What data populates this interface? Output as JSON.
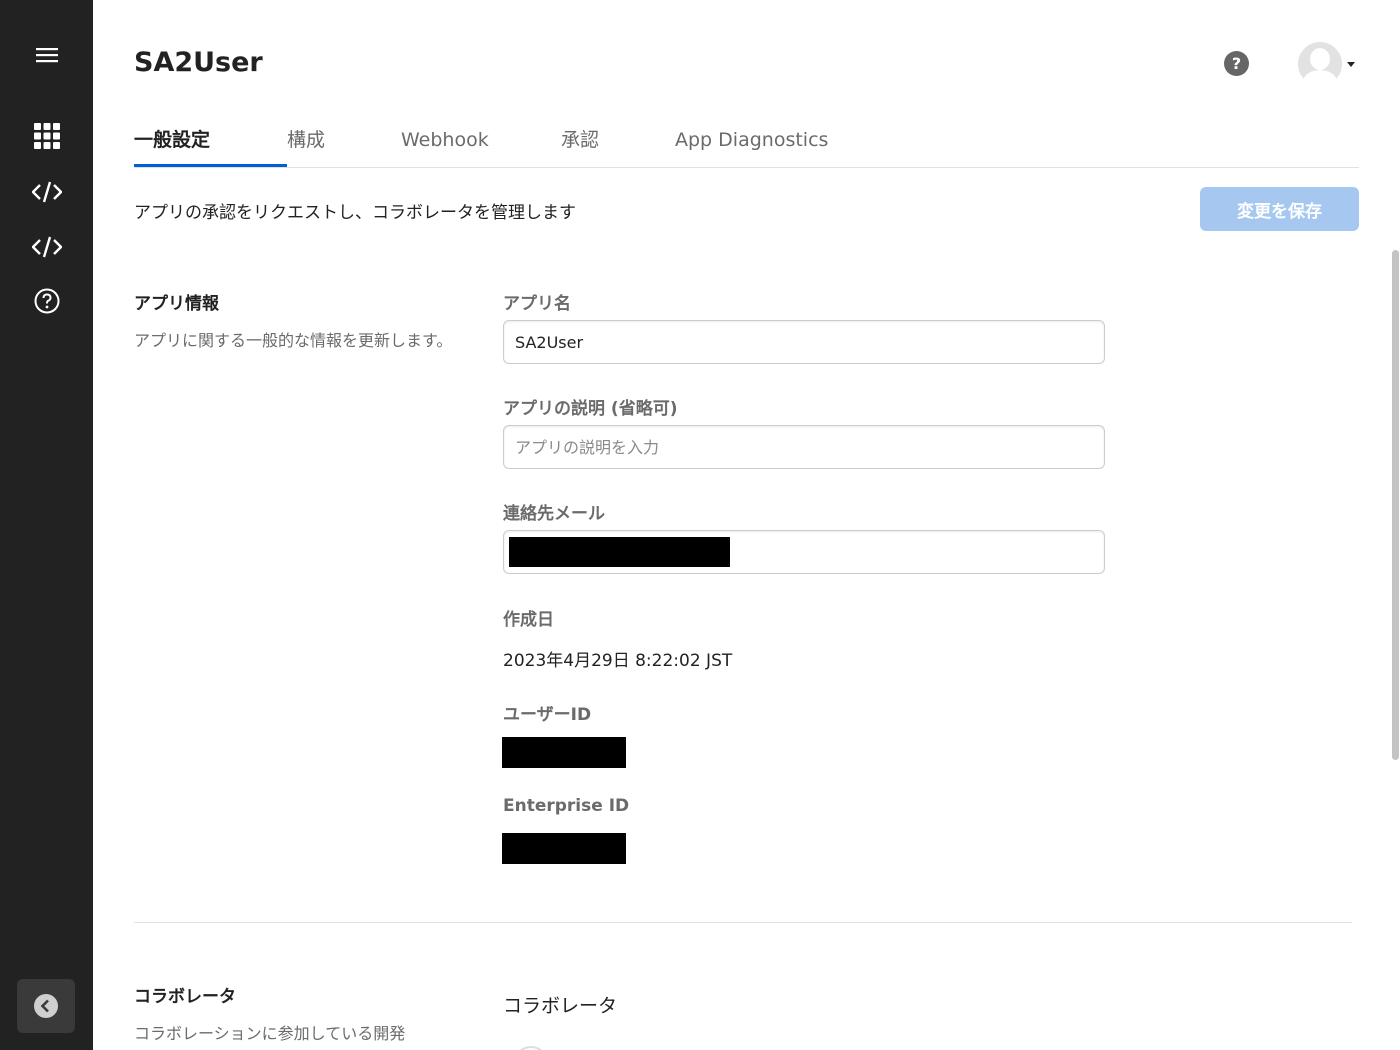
{
  "sidebar": {
    "menu_icon": "hamburger-icon",
    "items": [
      {
        "icon": "apps-grid-icon"
      },
      {
        "icon": "code-icon"
      },
      {
        "icon": "code-icon"
      },
      {
        "icon": "help-icon"
      }
    ],
    "collapse_icon": "chevron-left-icon",
    "background": "#222222"
  },
  "header": {
    "title": "SA2User",
    "help_label": "?",
    "avatar_icon": "user-avatar-icon"
  },
  "tabs": [
    {
      "label": "一般設定",
      "active": true
    },
    {
      "label": "構成",
      "active": false
    },
    {
      "label": "Webhook",
      "active": false
    },
    {
      "label": "承認",
      "active": false
    },
    {
      "label": "App Diagnostics",
      "active": false
    }
  ],
  "page": {
    "subtitle": "アプリの承認をリクエストし、コラボレータを管理します",
    "save_label": "変更を保存",
    "accent": "#0061d5",
    "save_button_color": "#a6c8f0"
  },
  "app_info": {
    "title": "アプリ情報",
    "description": "アプリに関する一般的な情報を更新します。",
    "name_label": "アプリ名",
    "name_value": "SA2User",
    "desc_label": "アプリの説明 (省略可)",
    "desc_placeholder": "アプリの説明を入力",
    "email_label": "連絡先メール",
    "created_label": "作成日",
    "created_value": "2023年4月29日 8:22:02 JST",
    "user_id_label": "ユーザーID",
    "enterprise_id_label": "Enterprise ID"
  },
  "collaborators": {
    "title": "コラボレータ",
    "description": "コラボレーションに参加している開発",
    "subheading": "コラボレータ"
  }
}
